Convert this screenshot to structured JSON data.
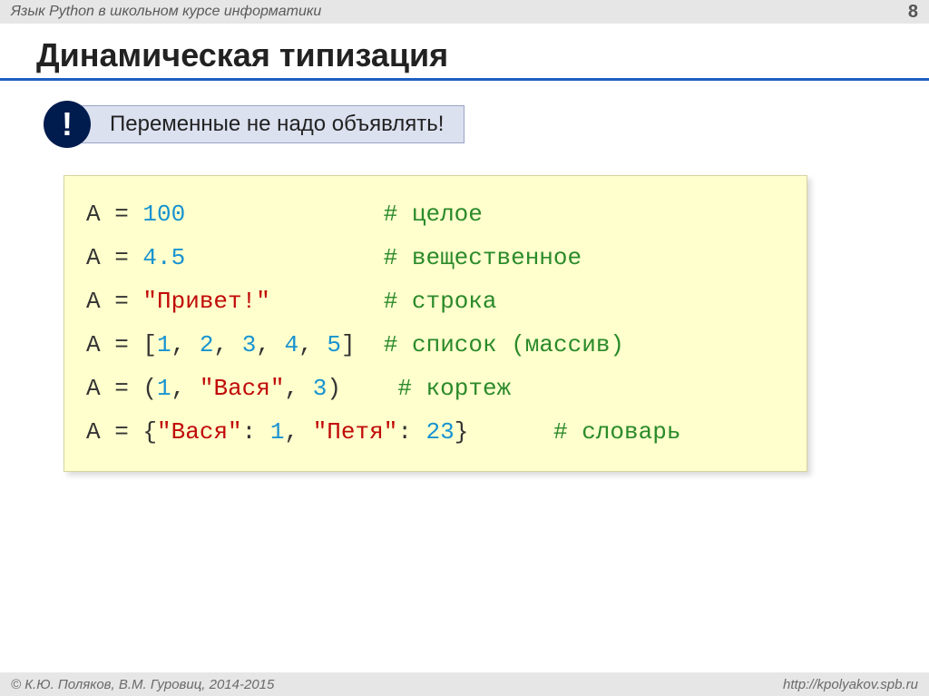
{
  "topbar": {
    "course": "Язык Python в школьном курсе информатики",
    "page": "8"
  },
  "title": "Динамическая типизация",
  "callout": {
    "bang": "!",
    "text": "Переменные не надо объявлять!"
  },
  "code": {
    "l1": {
      "var": "A",
      "eq": " = ",
      "val": "100",
      "pad": "              ",
      "cmt": "# целое"
    },
    "l2": {
      "var": "A",
      "eq": " = ",
      "val": "4.5",
      "pad": "              ",
      "cmt": "# вещественное"
    },
    "l3": {
      "var": "A",
      "eq": " = ",
      "val": "\"Привет!\"",
      "pad": "        ",
      "cmt": "# строка"
    },
    "l4": {
      "var": "A",
      "eq": " = ",
      "open": "[",
      "n1": "1",
      "c": ", ",
      "n2": "2",
      "n3": "3",
      "n4": "4",
      "n5": "5",
      "close": "]",
      "pad": "  ",
      "cmt": "# список (массив)"
    },
    "l5": {
      "var": "A",
      "eq": " = ",
      "open": "(",
      "n1": "1",
      "c": ", ",
      "s1": "\"Вася\"",
      "n2": "3",
      "close": ")",
      "pad": "    ",
      "cmt": "# кортеж"
    },
    "l6": {
      "var": "A",
      "eq": " = ",
      "open": "{",
      "k1": "\"Вася\"",
      "colon": ": ",
      "v1": "1",
      "c": ", ",
      "k2": "\"Петя\"",
      "v2": "23",
      "close": "}",
      "pad": "      ",
      "cmt": "# словарь"
    }
  },
  "footer": {
    "left": "© К.Ю. Поляков, В.М. Гуровиц, 2014-2015",
    "right": "http://kpolyakov.spb.ru"
  }
}
